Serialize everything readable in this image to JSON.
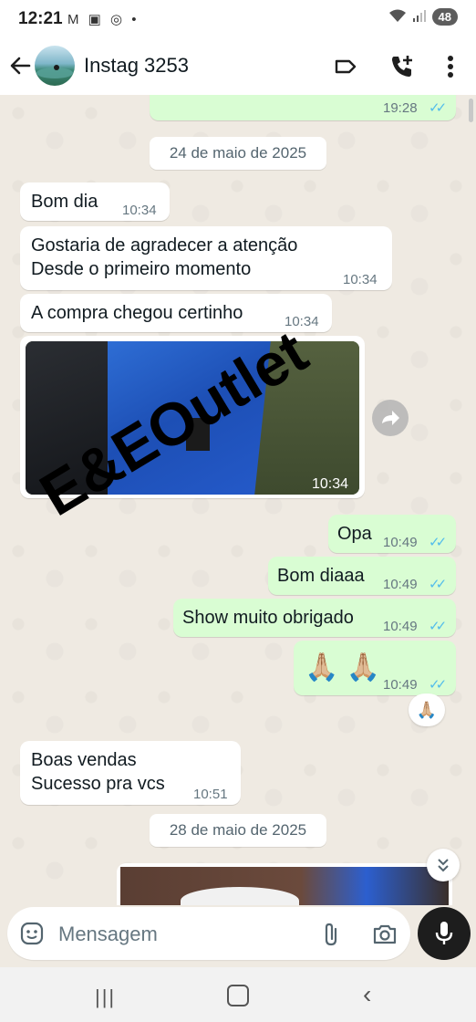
{
  "status_bar": {
    "time": "12:21",
    "notif_icons": "M ▣ ◎ •",
    "battery": "48"
  },
  "header": {
    "contact_name": "Instag 3253"
  },
  "messages": {
    "top_partial": {
      "time": "19:28"
    },
    "date1": "24 de maio de 2025",
    "m1": {
      "text": "Bom dia",
      "time": "10:34"
    },
    "m2": {
      "line1": "Gostaria de agradecer a atenção",
      "line2": "Desde o primeiro momento",
      "time": "10:34"
    },
    "m3": {
      "text": "A compra chegou certinho",
      "time": "10:34"
    },
    "m4_image": {
      "time": "10:34"
    },
    "o1": {
      "text": "Opa",
      "time": "10:49"
    },
    "o2": {
      "text": "Bom diaaa",
      "time": "10:49"
    },
    "o3": {
      "text": "Show muito obrigado",
      "time": "10:49"
    },
    "o4": {
      "text": "🙏🏼 🙏🏼",
      "time": "10:49"
    },
    "reaction": "🙏🏼",
    "m5": {
      "line1": "Boas vendas",
      "line2": "Sucesso pra vcs",
      "time": "10:51"
    },
    "date2": "28 de maio de 2025"
  },
  "ticks": "✓✓",
  "watermark": "E&EOutlet",
  "input": {
    "placeholder": "Mensagem"
  },
  "colors": {
    "outgoing": "#d9fdd3",
    "incoming": "#ffffff",
    "read_ticks": "#53bdeb",
    "chat_bg": "#efeae2"
  },
  "icons": [
    "back-arrow-icon",
    "label-icon",
    "add-call-icon",
    "more-vert-icon",
    "forward-icon",
    "chevron-double-down-icon",
    "sticker-icon",
    "attach-icon",
    "camera-icon",
    "mic-icon"
  ]
}
